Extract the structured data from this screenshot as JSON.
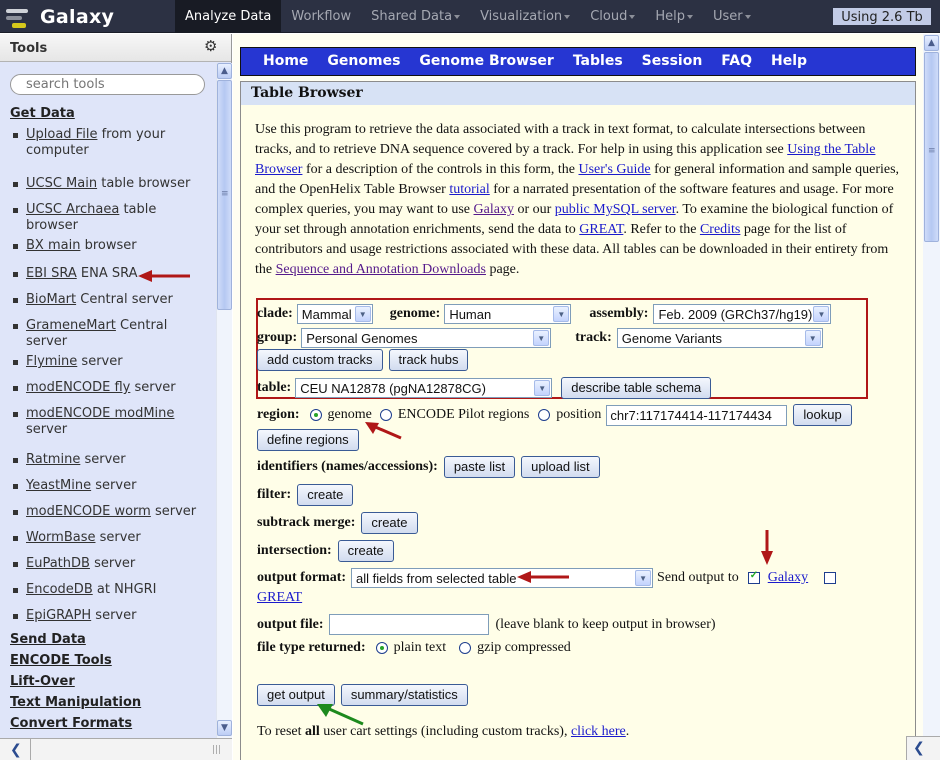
{
  "masthead": {
    "brand": "Galaxy",
    "nav": [
      {
        "label": "Analyze Data",
        "active": true,
        "dropdown": false
      },
      {
        "label": "Workflow",
        "active": false,
        "dropdown": false
      },
      {
        "label": "Shared Data",
        "active": false,
        "dropdown": true
      },
      {
        "label": "Visualization",
        "active": false,
        "dropdown": true
      },
      {
        "label": "Cloud",
        "active": false,
        "dropdown": true
      },
      {
        "label": "Help",
        "active": false,
        "dropdown": true
      },
      {
        "label": "User",
        "active": false,
        "dropdown": true
      }
    ],
    "quota": "Using 2.6 Tb"
  },
  "tools_panel": {
    "title": "Tools",
    "search_placeholder": "search tools",
    "get_data_title": "Get Data",
    "get_data_items": [
      {
        "link": "Upload File",
        "rest": " from your computer"
      },
      {
        "link": "UCSC Main",
        "rest": " table browser"
      },
      {
        "link": "UCSC Archaea",
        "rest": " table browser"
      },
      {
        "link": "BX main",
        "rest": " browser"
      },
      {
        "link": "EBI SRA",
        "rest": " ENA SRA"
      },
      {
        "link": "BioMart",
        "rest": " Central server"
      },
      {
        "link": "GrameneMart",
        "rest": " Central server"
      },
      {
        "link": "Flymine",
        "rest": " server"
      },
      {
        "link": "modENCODE fly",
        "rest": " server"
      },
      {
        "link": "modENCODE modMine",
        "rest": " server"
      },
      {
        "link": "Ratmine",
        "rest": " server"
      },
      {
        "link": "YeastMine",
        "rest": " server"
      },
      {
        "link": "modENCODE worm",
        "rest": " server"
      },
      {
        "link": "WormBase",
        "rest": " server"
      },
      {
        "link": "EuPathDB",
        "rest": " server"
      },
      {
        "link": "EncodeDB",
        "rest": " at NHGRI"
      },
      {
        "link": "EpiGRAPH",
        "rest": " server"
      }
    ],
    "sections": [
      "Send Data",
      "ENCODE Tools",
      "Lift-Over",
      "Text Manipulation",
      "Convert Formats"
    ]
  },
  "ucsc_nav": [
    "Home",
    "Genomes",
    "Genome Browser",
    "Tables",
    "Session",
    "FAQ",
    "Help"
  ],
  "table_browser": {
    "title": "Table Browser",
    "intro": {
      "t1": "Use this program to retrieve the data associated with a track in text format, to calculate intersections between tracks, and to retrieve DNA sequence covered by a track. For help in using this application see ",
      "l1": "Using the Table Browser",
      "t2": " for a description of the controls in this form, the ",
      "l2": "User's Guide",
      "t3": " for general information and sample queries, and the OpenHelix Table Browser ",
      "l3": "tutorial",
      "t4": " for a narrated presentation of the software features and usage. For more complex queries, you may want to use ",
      "l4": "Galaxy",
      "t5": " or our ",
      "l5": "public MySQL server",
      "t6": ". To examine the biological function of your set through annotation enrichments, send the data to ",
      "l6": "GREAT",
      "t7": ". Refer to the ",
      "l7": "Credits",
      "t8": " page for the list of contributors and usage restrictions associated with these data. All tables can be downloaded in their entirety from the ",
      "l8": "Sequence and Annotation Downloads",
      "t9": " page."
    },
    "clade_label": "clade:",
    "clade_value": "Mammal",
    "genome_label": "genome:",
    "genome_value": "Human",
    "assembly_label": "assembly:",
    "assembly_value": "Feb. 2009 (GRCh37/hg19)",
    "group_label": "group:",
    "group_value": "Personal Genomes",
    "track_label": "track:",
    "track_value": "Genome Variants",
    "add_custom_tracks": "add custom tracks",
    "track_hubs": "track hubs",
    "table_label": "table:",
    "table_value": "CEU NA12878 (pgNA12878CG)",
    "describe_schema": "describe table schema",
    "region_label": "region:",
    "region_options": [
      "genome",
      "ENCODE Pilot regions",
      "position"
    ],
    "region_selected": "genome",
    "position_value": "chr7:117174414-117174434",
    "lookup": "lookup",
    "define_regions": "define regions",
    "identifiers_label": "identifiers (names/accessions):",
    "paste_list": "paste list",
    "upload_list": "upload list",
    "filter_label": "filter:",
    "subtrack_label": "subtrack merge:",
    "intersection_label": "intersection:",
    "create": "create",
    "output_format_label": "output format:",
    "output_format_value": "all fields from selected table",
    "send_output_to": "Send output to",
    "send_galaxy": "Galaxy",
    "send_galaxy_checked": true,
    "send_great": "GREAT",
    "send_great_checked": false,
    "output_file_label": "output file:",
    "output_file_value": "",
    "output_file_hint": "(leave blank to keep output in browser)",
    "file_type_label": "file type returned:",
    "file_type_options": [
      "plain text",
      "gzip compressed"
    ],
    "file_type_selected": "plain text",
    "get_output": "get output",
    "summary_statistics": "summary/statistics",
    "reset_t1": "To reset ",
    "reset_bold": "all",
    "reset_t2": " user cart settings (including custom tracks), ",
    "reset_link": "click here",
    "reset_t3": "."
  },
  "colors": {
    "masthead_bg": "#2c3143",
    "ucsc_nav_bg": "#2636d2",
    "tool_panel_bg": "#dfe5f9",
    "annotation_red": "#b01717",
    "annotation_green": "#1d8a1d"
  }
}
